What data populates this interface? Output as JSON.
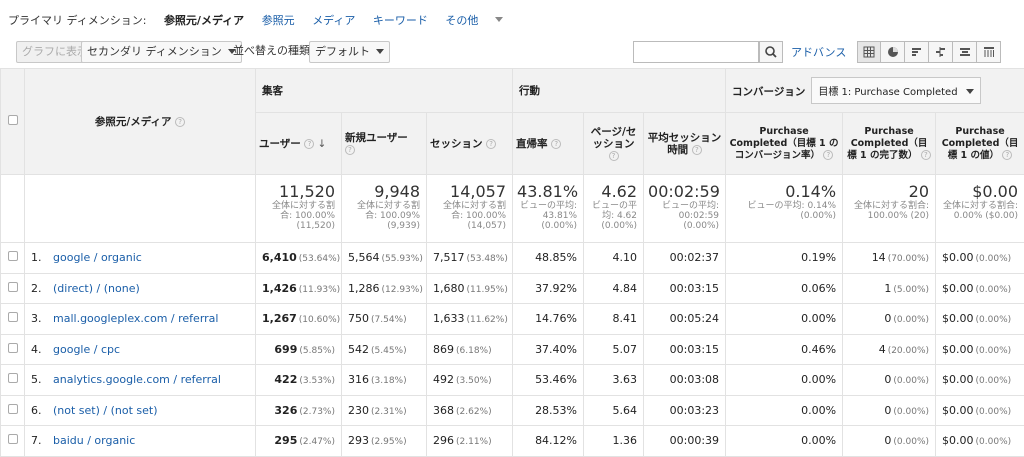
{
  "dimension_bar": {
    "primary_label": "プライマリ ディメンション:",
    "active": "参照元/メディア",
    "options": [
      "参照元",
      "メディア",
      "キーワード"
    ],
    "more": "その他"
  },
  "toolbar": {
    "graph_button": "グラフに表示",
    "secondary_dimension": "セカンダリ ディメンション",
    "sort_label": "並べ替えの種類:",
    "sort_value": "デフォルト",
    "search_value": "",
    "advanced": "アドバンス"
  },
  "groups": {
    "acquisition": "集客",
    "behavior": "行動",
    "conversions": "コンバージョン",
    "goal_select": "目標 1: Purchase Completed"
  },
  "columns": {
    "dimension": "参照元/メディア",
    "users": "ユーザー",
    "new_users": "新規ユーザー",
    "sessions": "セッション",
    "bounce_rate": "直帰率",
    "pages_per_session": "ページ/セッション",
    "avg_session_duration": "平均セッション時間",
    "goal_conv_rate": "Purchase Completed（目標 1 のコンバージョン率）",
    "goal_completions": "Purchase Completed（目標 1 の完了数）",
    "goal_value": "Purchase Completed（目標 1 の値）"
  },
  "totals": {
    "users": {
      "value": "11,520",
      "sub": "全体に対する割合: 100.00% (11,520)"
    },
    "new_users": {
      "value": "9,948",
      "sub": "全体に対する割合: 100.09% (9,939)"
    },
    "sessions": {
      "value": "14,057",
      "sub": "全体に対する割合: 100.00% (14,057)"
    },
    "bounce_rate": {
      "value": "43.81%",
      "sub": "ビューの平均: 43.81% (0.00%)"
    },
    "pages_per_session": {
      "value": "4.62",
      "sub": "ビューの平均: 4.62 (0.00%)"
    },
    "avg_session_duration": {
      "value": "00:02:59",
      "sub": "ビューの平均: 00:02:59 (0.00%)"
    },
    "goal_conv_rate": {
      "value": "0.14%",
      "sub": "ビューの平均: 0.14% (0.00%)"
    },
    "goal_completions": {
      "value": "20",
      "sub": "全体に対する割合: 100.00% (20)"
    },
    "goal_value": {
      "value": "$0.00",
      "sub": "全体に対する割合: 0.00% ($0.00)"
    }
  },
  "rows": [
    {
      "index": "1.",
      "source": "google / organic",
      "users": "6,410",
      "users_pct": "(53.64%)",
      "new_users": "5,564",
      "new_users_pct": "(55.93%)",
      "sessions": "7,517",
      "sessions_pct": "(53.48%)",
      "bounce": "48.85%",
      "pps": "4.10",
      "duration": "00:02:37",
      "conv_rate": "0.19%",
      "completions": "14",
      "completions_pct": "(70.00%)",
      "value": "$0.00",
      "value_pct": "(0.00%)"
    },
    {
      "index": "2.",
      "source": "(direct) / (none)",
      "users": "1,426",
      "users_pct": "(11.93%)",
      "new_users": "1,286",
      "new_users_pct": "(12.93%)",
      "sessions": "1,680",
      "sessions_pct": "(11.95%)",
      "bounce": "37.92%",
      "pps": "4.84",
      "duration": "00:03:15",
      "conv_rate": "0.06%",
      "completions": "1",
      "completions_pct": "(5.00%)",
      "value": "$0.00",
      "value_pct": "(0.00%)"
    },
    {
      "index": "3.",
      "source": "mall.googleplex.com / referral",
      "users": "1,267",
      "users_pct": "(10.60%)",
      "new_users": "750",
      "new_users_pct": "(7.54%)",
      "sessions": "1,633",
      "sessions_pct": "(11.62%)",
      "bounce": "14.76%",
      "pps": "8.41",
      "duration": "00:05:24",
      "conv_rate": "0.00%",
      "completions": "0",
      "completions_pct": "(0.00%)",
      "value": "$0.00",
      "value_pct": "(0.00%)"
    },
    {
      "index": "4.",
      "source": "google / cpc",
      "users": "699",
      "users_pct": "(5.85%)",
      "new_users": "542",
      "new_users_pct": "(5.45%)",
      "sessions": "869",
      "sessions_pct": "(6.18%)",
      "bounce": "37.40%",
      "pps": "5.07",
      "duration": "00:03:15",
      "conv_rate": "0.46%",
      "completions": "4",
      "completions_pct": "(20.00%)",
      "value": "$0.00",
      "value_pct": "(0.00%)"
    },
    {
      "index": "5.",
      "source": "analytics.google.com / referral",
      "users": "422",
      "users_pct": "(3.53%)",
      "new_users": "316",
      "new_users_pct": "(3.18%)",
      "sessions": "492",
      "sessions_pct": "(3.50%)",
      "bounce": "53.46%",
      "pps": "3.63",
      "duration": "00:03:08",
      "conv_rate": "0.00%",
      "completions": "0",
      "completions_pct": "(0.00%)",
      "value": "$0.00",
      "value_pct": "(0.00%)"
    },
    {
      "index": "6.",
      "source": "(not set) / (not set)",
      "users": "326",
      "users_pct": "(2.73%)",
      "new_users": "230",
      "new_users_pct": "(2.31%)",
      "sessions": "368",
      "sessions_pct": "(2.62%)",
      "bounce": "28.53%",
      "pps": "5.64",
      "duration": "00:03:23",
      "conv_rate": "0.00%",
      "completions": "0",
      "completions_pct": "(0.00%)",
      "value": "$0.00",
      "value_pct": "(0.00%)"
    },
    {
      "index": "7.",
      "source": "baidu / organic",
      "users": "295",
      "users_pct": "(2.47%)",
      "new_users": "293",
      "new_users_pct": "(2.95%)",
      "sessions": "296",
      "sessions_pct": "(2.11%)",
      "bounce": "84.12%",
      "pps": "1.36",
      "duration": "00:00:39",
      "conv_rate": "0.00%",
      "completions": "0",
      "completions_pct": "(0.00%)",
      "value": "$0.00",
      "value_pct": "(0.00%)"
    }
  ]
}
